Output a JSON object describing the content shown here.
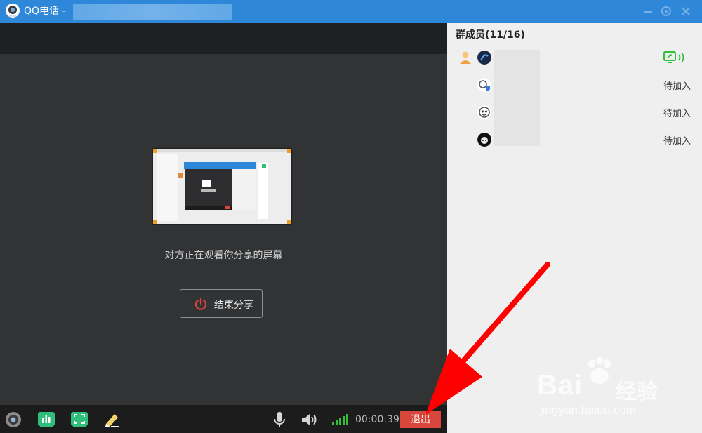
{
  "window": {
    "title": "QQ电话 -",
    "icons": {
      "app": "qq-app-icon",
      "minimize": "minimize-icon",
      "settings": "gear-icon",
      "close": "close-icon"
    }
  },
  "share": {
    "status_text": "对方正在观看你分享的屏幕",
    "end_button_label": "结束分享"
  },
  "toolbar": {
    "icons": [
      "camera-icon",
      "share-screen-icon",
      "fullscreen-icon",
      "whiteboard-pen-icon",
      "microphone-icon",
      "speaker-icon",
      "signal-icon"
    ],
    "timer": "00:00:39",
    "exit_label": "退出"
  },
  "sidebar": {
    "title": "群成员(11/16)",
    "members": [
      {
        "avatar": "avatar-host",
        "host": true,
        "status": "",
        "sharing": true
      },
      {
        "avatar": "avatar-2",
        "host": false,
        "status": "待加入",
        "sharing": false
      },
      {
        "avatar": "avatar-3",
        "host": false,
        "status": "待加入",
        "sharing": false
      },
      {
        "avatar": "avatar-4",
        "host": false,
        "status": "待加入",
        "sharing": false
      }
    ]
  },
  "watermark": {
    "brand": "Bai",
    "brand_cn": "经验",
    "url": "jingyan.baidu.com"
  },
  "colors": {
    "titlebar": "#2f87d9",
    "exit_button": "#d9463c",
    "accent_green": "#2fbf7a",
    "arrow": "#ff0000"
  }
}
